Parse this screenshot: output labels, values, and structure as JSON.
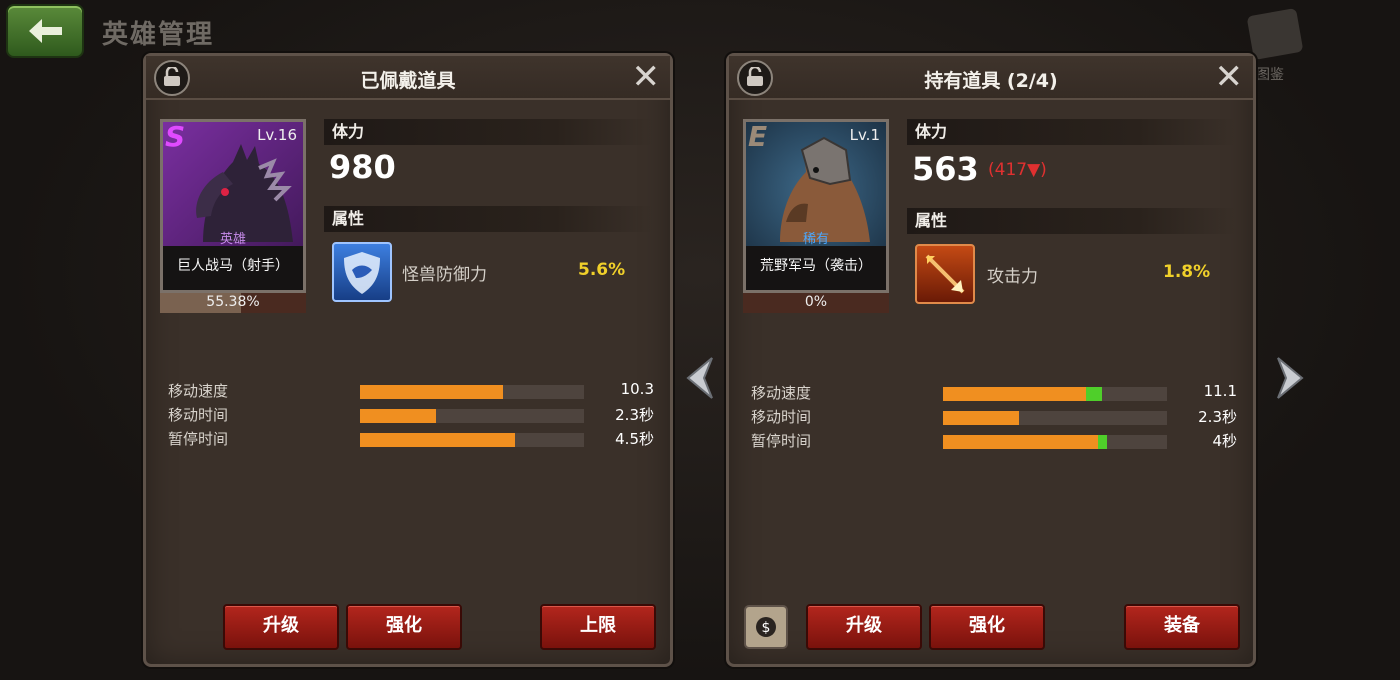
{
  "header": {
    "title": "英雄管理",
    "codex_label": "图鉴"
  },
  "equipped": {
    "title": "已佩戴道具",
    "grade": "S",
    "level": "Lv.16",
    "rarity": "英雄",
    "name": "巨人战马（射手）",
    "exp_text": "55.38%",
    "exp_fraction": 0.5538,
    "hp_label": "体力",
    "hp": "980",
    "attr_label": "属性",
    "attr_name": "怪兽防御力",
    "attr_value": "5.6%",
    "stats": [
      {
        "label": "移动速度",
        "value": "10.3",
        "fill": 0.64
      },
      {
        "label": "移动时间",
        "value": "2.3秒",
        "fill": 0.34
      },
      {
        "label": "暂停时间",
        "value": "4.5秒",
        "fill": 0.69
      }
    ],
    "buttons": {
      "upgrade": "升级",
      "enhance": "强化",
      "limit": "上限"
    }
  },
  "owned": {
    "title": "持有道具 (2/4)",
    "grade": "E",
    "level": "Lv.1",
    "rarity": "稀有",
    "name": "荒野军马（袭击）",
    "exp_text": "0%",
    "exp_fraction": 0,
    "hp_label": "体力",
    "hp": "563",
    "hp_diff": "(417▼)",
    "attr_label": "属性",
    "attr_name": "攻击力",
    "attr_value": "1.8%",
    "stats": [
      {
        "label": "移动速度",
        "value": "11.1",
        "fill": 0.64,
        "gain": 0.07
      },
      {
        "label": "移动时间",
        "value": "2.3秒",
        "fill": 0.34,
        "gain": 0
      },
      {
        "label": "暂停时间",
        "value": "4秒",
        "fill": 0.69,
        "gain": 0.04
      }
    ],
    "buttons": {
      "upgrade": "升级",
      "enhance": "强化",
      "equip": "装备"
    }
  },
  "colors": {
    "grade_s": "#b43ad8",
    "grade_e": "#8a7a6a",
    "rarity_hero": "#b06ad8",
    "rarity_rare": "#3aa0ff",
    "attr_value": "#f0d02a",
    "bar_fill": "#f08f20",
    "bar_gain": "#4fcf2a"
  }
}
